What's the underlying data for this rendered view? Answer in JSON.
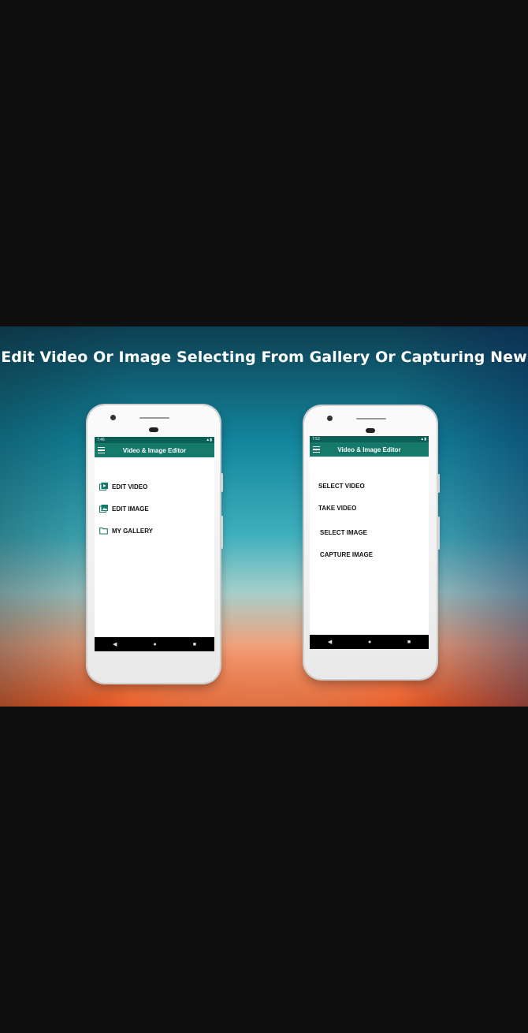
{
  "headline": "Edit Video Or Image Selecting From Gallery Or Capturing New",
  "phone_left": {
    "status_time": "7:46",
    "app_title": "Video & Image Editor",
    "menu": [
      {
        "label": "EDIT VIDEO",
        "icon": "video-library-icon"
      },
      {
        "label": "EDIT IMAGE",
        "icon": "image-library-icon"
      },
      {
        "label": "MY GALLERY",
        "icon": "folder-icon"
      }
    ],
    "nav": {
      "back": "◀",
      "home": "●",
      "recents": "■"
    }
  },
  "phone_right": {
    "status_time": "7:53",
    "app_title": "Video & Image Editor",
    "menu": [
      {
        "label": "SELECT VIDEO"
      },
      {
        "label": "TAKE VIDEO"
      },
      {
        "label": "SELECT IMAGE"
      },
      {
        "label": "CAPTURE IMAGE"
      }
    ],
    "nav": {
      "back": "◀",
      "home": "●",
      "recents": "■"
    }
  },
  "colors": {
    "appbar": "#167a6b",
    "statusbar": "#0b5f56",
    "icon": "#167a6b",
    "page_bg": "#0f0f0f"
  }
}
